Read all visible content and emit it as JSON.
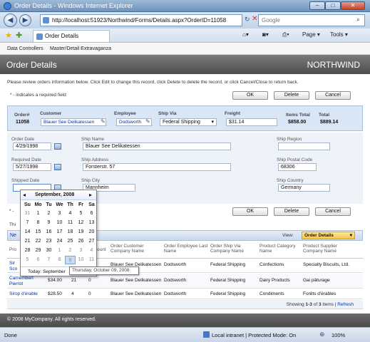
{
  "window": {
    "title": "Order Details - Windows Internet Explorer"
  },
  "browser": {
    "address": "http://localhost:51923/Northwind/Forms/Details.aspx?OrderID=11058",
    "search_placeholder": "Google",
    "tab_label": "Order Details",
    "page_menu": "Page",
    "tools_menu": "Tools"
  },
  "menu": {
    "items": [
      "Data Controllers",
      "Master/Detail Extravaganza"
    ]
  },
  "header": {
    "title": "Order Details",
    "brand": "NORTHWIND"
  },
  "instructions": "Please review orders information below. Click Edit to change this record, click Delete to delete the record, or click Cancel/Close to return back.",
  "required_note": "* - indicates a required field",
  "buttons": {
    "ok": "OK",
    "delete": "Delete",
    "cancel": "Cancel"
  },
  "summary": {
    "order_label": "Order#",
    "order_value": "11058",
    "customer_label": "Customer",
    "customer_value": "Blauer See Delikatessen",
    "employee_label": "Employee",
    "employee_value": "Dodsworth",
    "shipvia_label": "Ship Via",
    "shipvia_value": "Federal Shipping",
    "freight_label": "Freight",
    "freight_value": "$31.14",
    "items_total_label": "Items Total",
    "items_total_value": "$858.00",
    "total_label": "Total",
    "total_value": "$889.14"
  },
  "form": {
    "order_date_label": "Order Date",
    "order_date": "4/29/1998",
    "required_date_label": "Required Date",
    "required_date": "5/27/1998",
    "shipped_date_label": "Shipped Date",
    "shipped_date": "",
    "ship_name_label": "Ship Name",
    "ship_name": "Blauer See Delikatessen",
    "ship_address_label": "Ship Address",
    "ship_address": "Forsterstr. 57",
    "ship_city_label": "Ship City",
    "ship_city": "Mannheim",
    "ship_region_label": "Ship Region",
    "ship_region": "",
    "ship_postal_label": "Ship Postal Code",
    "ship_postal": "68306",
    "ship_country_label": "Ship Country",
    "ship_country": "Germany"
  },
  "calendar": {
    "month_label": "September, 2008",
    "prev": "◂",
    "next": "▸",
    "weekdays": [
      "Su",
      "Mo",
      "Tu",
      "We",
      "Th",
      "Fr",
      "Sa"
    ],
    "weeks": [
      [
        "31",
        "1",
        "2",
        "3",
        "4",
        "5",
        "6"
      ],
      [
        "7",
        "8",
        "9",
        "10",
        "11",
        "12",
        "13"
      ],
      [
        "14",
        "15",
        "16",
        "17",
        "18",
        "19",
        "20"
      ],
      [
        "21",
        "22",
        "23",
        "24",
        "25",
        "26",
        "27"
      ],
      [
        "28",
        "29",
        "30",
        "1",
        "2",
        "3",
        "4"
      ],
      [
        "5",
        "6",
        "7",
        "8",
        "9",
        "10",
        "11"
      ]
    ],
    "today_label": "Today: September",
    "tooltip": "Thursday, October 09, 2008"
  },
  "detail_bits": {
    "dash_frag": "* -",
    "th_frag": "Thi",
    "ne_frag": "Ne",
    "pr_frag": "Pro"
  },
  "grid": {
    "view_label": "View:",
    "view_value": "Order Details",
    "columns": [
      "Order Customer Company Name",
      "Order Employee Last Name",
      "Order Ship Via Company Name",
      "Product Category Name",
      "Product Supplier Company Name"
    ],
    "amount_frag": "ount",
    "rows": [
      {
        "product": "Sir Sco",
        "price": "",
        "qty": "",
        "disc": "",
        "customer": "Blauer See Delikatessen",
        "employee": "Dodsworth",
        "shipvia": "Federal Shipping",
        "category": "Confections",
        "supplier": "Specialty Biscuits, Ltd."
      },
      {
        "product": "Camembert Pierrot",
        "price": "$34.00",
        "qty": "21",
        "disc": "0",
        "customer": "Blauer See Delikatessen",
        "employee": "Dodsworth",
        "shipvia": "Federal Shipping",
        "category": "Dairy Products",
        "supplier": "Gai pâturage"
      },
      {
        "product": "Sirop d'érable",
        "price": "$28.50",
        "qty": "4",
        "disc": "0",
        "customer": "Blauer See Delikatessen",
        "employee": "Dodsworth",
        "shipvia": "Federal Shipping",
        "category": "Condiments",
        "supplier": "Forêts d'érables"
      }
    ],
    "paging_prefix": "Showing",
    "paging_range": "1-3",
    "paging_of": "of",
    "paging_count": "3",
    "paging_items": "items |",
    "refresh": "Refresh"
  },
  "footer": {
    "copyright": "© 2008 MyCompany. All rights reserved."
  },
  "status": {
    "left": "Done",
    "zone": "Local intranet | Protected Mode: On",
    "zoom": "100%"
  }
}
